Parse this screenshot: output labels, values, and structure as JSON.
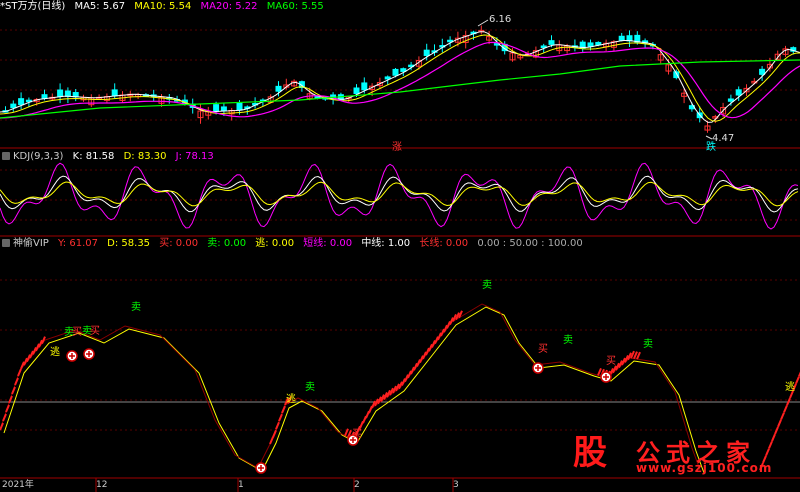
{
  "window": {
    "title": "*ST万方(日线)",
    "watermark": {
      "glyph": "股",
      "name": "公式之家",
      "url": "www.gszj100.com"
    }
  },
  "main_panel": {
    "indicators": [
      {
        "label": "MA5: 5.67",
        "color": "#ffffff"
      },
      {
        "label": "MA10: 5.54",
        "color": "#ffff00"
      },
      {
        "label": "MA20: 5.22",
        "color": "#ff00ff"
      },
      {
        "label": "MA60: 5.55",
        "color": "#00ff00"
      }
    ],
    "price_high_label": "6.16",
    "price_low_label": "4.47",
    "marker_up": "涨",
    "marker_down": "跌"
  },
  "kdj_panel": {
    "name": "KDJ(9,3,3)",
    "values": [
      {
        "label": "K: 81.58",
        "color": "#ffffff"
      },
      {
        "label": "D: 83.30",
        "color": "#ffff00"
      },
      {
        "label": "J: 78.13",
        "color": "#ff00ff"
      }
    ]
  },
  "vip_panel": {
    "name": "神偷VIP",
    "values": [
      {
        "label": "Y: 61.07",
        "color": "#ff3030"
      },
      {
        "label": "D: 58.35",
        "color": "#ffff00"
      },
      {
        "label": "买: 0.00",
        "color": "#ff3030"
      },
      {
        "label": "卖: 0.00",
        "color": "#00ff00"
      },
      {
        "label": "逃: 0.00",
        "color": "#ffff00"
      },
      {
        "label": "短线: 0.00",
        "color": "#ff00ff"
      },
      {
        "label": "中线: 1.00",
        "color": "#ffffff"
      },
      {
        "label": "长线: 0.00",
        "color": "#ff3030"
      },
      {
        "label": "0.00 : 50.00 : 100.00",
        "color": "#aaaaaa"
      }
    ],
    "signals": {
      "buy": "买",
      "sell": "卖",
      "escape": "逃"
    }
  },
  "time_axis": [
    "2021年",
    "12",
    "1",
    "2",
    "3"
  ],
  "colors": {
    "up": "#ff3232",
    "down": "#00ffff",
    "grid": "#8b0000",
    "ma5": "#ffffff",
    "ma10": "#ffff00",
    "ma20": "#ff00ff",
    "ma60": "#00ff00"
  }
}
